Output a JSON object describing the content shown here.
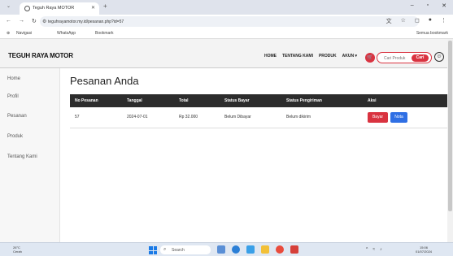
{
  "browser": {
    "tab_title": "Teguh Raya MOTOR",
    "url": "teguhrayamotor.my.id/pesanan.php?id=57",
    "bookmarks": [
      "Navigasi",
      "WhatsApp",
      "Bookmark"
    ],
    "bookmarks_right": "Semua bookmark"
  },
  "site": {
    "brand": "TEGUH RAYA MOTOR",
    "menu": [
      "HOME",
      "TENTANG KAMI",
      "PRODUK",
      "AKUN ▾"
    ],
    "search_placeholder": "Cari Produk",
    "search_button": "Cari"
  },
  "sidebar": {
    "items": [
      "Home",
      "Profil",
      "Pesanan",
      "Produk",
      "Tentang Kami"
    ]
  },
  "main": {
    "title": "Pesanan Anda",
    "columns": [
      "No Pesanan",
      "Tanggal",
      "Total",
      "Status Bayar",
      "Status Pengiriman",
      "Aksi"
    ],
    "rows": [
      {
        "no": "57",
        "date": "2024-07-01",
        "total": "Rp 32.000",
        "pay_status": "Belum Dibayar",
        "ship_status": "Belum dikirim",
        "btn_pay": "Bayar",
        "btn_detail": "Nota"
      }
    ]
  },
  "taskbar": {
    "weather_temp": "26°C",
    "weather_desc": "Cerah",
    "search": "Search",
    "time": "15:06",
    "date": "01/07/2024"
  },
  "colors": {
    "accent": "#d93340",
    "header": "#2c2c2c",
    "blue": "#2f6fe4"
  }
}
